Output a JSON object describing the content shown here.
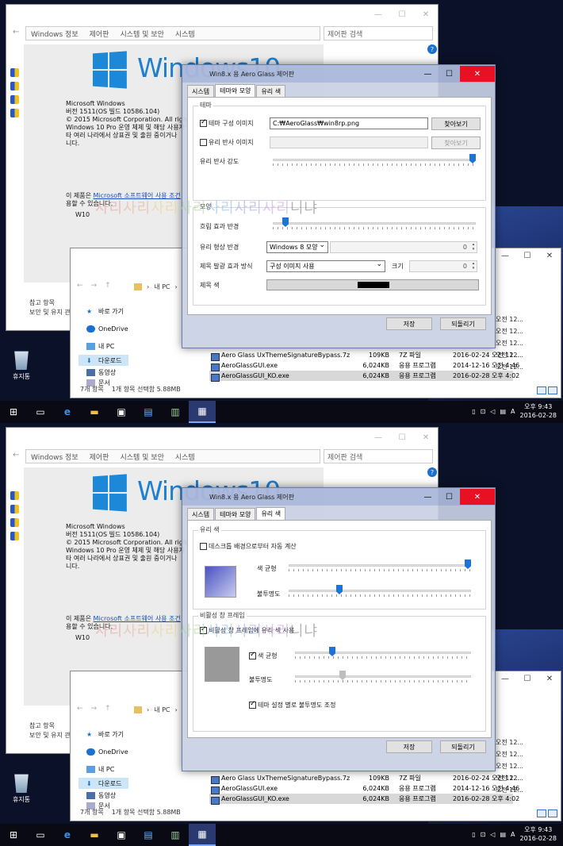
{
  "control_panel": {
    "address": [
      "Windows 정보",
      "제어판",
      "시스템 및 보안",
      "시스템"
    ],
    "search_placeholder": "제어판 검색",
    "help": "?",
    "logo_text": "Windows10",
    "info_lines": [
      "Microsoft Windows",
      "버전 1511(OS 빌드 10586.104)",
      "© 2015 Microsoft Corporation. All rights",
      "Windows 10 Pro 운영 체제 및 해당 사용자",
      "타 여러 나라에서 상표권 및 출원 중이거나",
      "니다."
    ],
    "license_prefix": "이 제품은 ",
    "license_link": "Microsoft 소프트웨어 사용 조건",
    "license_suffix": "용할 수 있습니다.",
    "user": "W10",
    "bottom_links": [
      "참고 항목",
      "보안 및 유지 관리"
    ]
  },
  "explorer": {
    "address": "내 PC",
    "nav": [
      "바로 가기",
      "OneDrive",
      "내 PC",
      "다운로드",
      "동영상",
      "문서"
    ],
    "files": [
      {
        "name": "Aero Glass UxThemeSignatureBypass.7z",
        "size": "109KB",
        "type": "7Z 파일",
        "date": "2016-02-24 오전 12..."
      },
      {
        "name": "AeroGlassGUI.exe",
        "size": "6,024KB",
        "type": "응용 프로그램",
        "date": "2014-12-16 오전 4:46"
      },
      {
        "name": "AeroGlassGUI_KO.exe",
        "size": "6,024KB",
        "type": "응용 프로그램",
        "date": "2016-02-28 오후 4:02"
      }
    ],
    "right_dates": [
      "오전 12...",
      "오전 12...",
      "오전 12...",
      "오전 12...",
      "오전 12..."
    ],
    "status_count": "7개 항목",
    "status_sel": "1개 항목 선택함 5.88MB"
  },
  "dialog": {
    "title": "Win8.x 용 Aero Glass 제어판",
    "tabs": [
      "시스템",
      "테마와 모양",
      "유리 색"
    ],
    "ok": "저장",
    "revert": "되돌리기"
  },
  "theme_tab": {
    "group_theme": "테마",
    "theme_image_label": "테마 구성 이미지",
    "theme_image_path": "C:₩AeroGlass₩win8rp.png",
    "browse": "찾아보기",
    "reflection_label": "유리 반사 이미지",
    "reflection_strength": "유리 반사 강도",
    "reflection_strength_value": 100,
    "group_shape": "모양",
    "blur_radius": "흐림 효과 반경",
    "blur_value": 5,
    "glass_shape_radius": "유리 형상 반경",
    "glass_shape_option": "Windows 8 모양",
    "shape_radius_value": "0",
    "title_glow": "제목 발광 효과 방식",
    "title_glow_option": "구성 이미지 사용",
    "size_label": "크기",
    "size_value": "0",
    "title_color": "제목 색",
    "title_color_value": "#000000"
  },
  "color_tab": {
    "group_glass": "유리 색",
    "auto_from_desktop": "데스크톱 배경으로부터 자동 계산",
    "color_balance": "색 균형",
    "color_balance_value": 100,
    "opacity": "불투명도",
    "opacity_value": 27,
    "glass_color": "#6a72c8",
    "group_inactive": "비활성 창 프레임",
    "inactive_use": "비활성 창 프레임에 유리 색 사용",
    "inactive_balance": "색 균형",
    "inactive_balance_value": 20,
    "inactive_opacity": "불투명도",
    "inactive_opacity_value": 26,
    "inactive_color": "#999999",
    "theme_opacity": "테마 설정 별로 불투명도 조정"
  },
  "watermark": [
    "사리",
    "사리",
    "사리",
    "사리",
    "사리",
    "사리",
    "사리",
    "니냐"
  ],
  "desktop": {
    "recycle_bin": "휴지통"
  },
  "taskbar": {
    "time": "오후 9:43",
    "date": "2016-02-28"
  }
}
